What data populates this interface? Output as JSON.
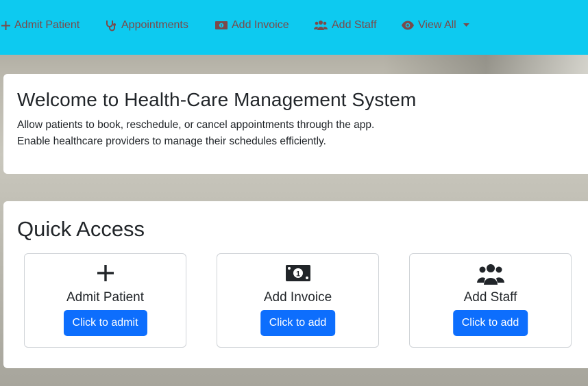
{
  "nav": {
    "items": [
      {
        "label": "Admit Patient",
        "icon": "plus-icon"
      },
      {
        "label": "Appointments",
        "icon": "stethoscope-icon"
      },
      {
        "label": "Add Invoice",
        "icon": "money-bill-icon"
      },
      {
        "label": "Add Staff",
        "icon": "users-icon"
      },
      {
        "label": "View All",
        "icon": "eye-icon",
        "dropdown": true
      }
    ],
    "color": "#0dcaf0",
    "text_color": "#7a4a4a"
  },
  "welcome": {
    "title": "Welcome to Health-Care Management System",
    "line1": "Allow patients to book, reschedule, or cancel appointments through the app.",
    "line2": "Enable healthcare providers to manage their schedules efficiently."
  },
  "quick_access": {
    "title": "Quick Access",
    "cards": [
      {
        "title": "Admit Patient",
        "button": "Click to admit",
        "icon": "plus-icon"
      },
      {
        "title": "Add Invoice",
        "button": "Click to add",
        "icon": "money-bill-icon"
      },
      {
        "title": "Add Staff",
        "button": "Click to add",
        "icon": "users-icon"
      }
    ],
    "button_color": "#0d6efd"
  }
}
